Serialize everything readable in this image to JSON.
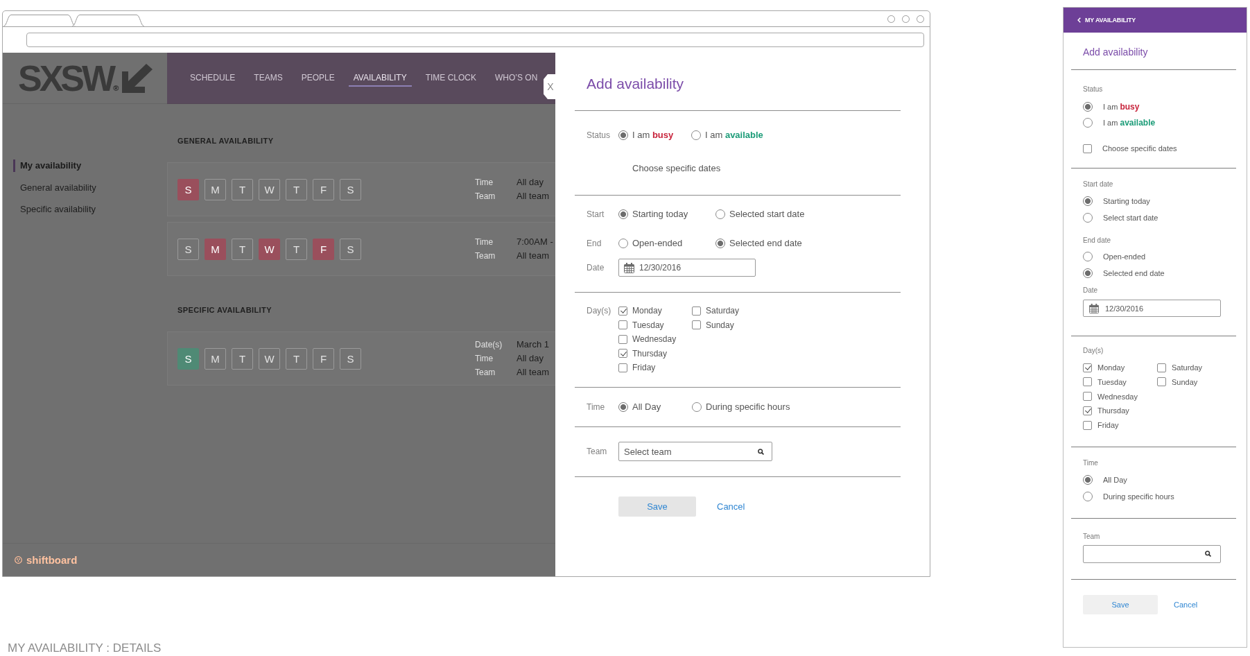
{
  "app": {
    "logo": "SXSW$_{®}$",
    "nav": [
      {
        "label": "SCHEDULE",
        "selected": false
      },
      {
        "label": "TEAMS",
        "selected": false
      },
      {
        "label": "PEOPLE",
        "selected": false
      },
      {
        "label": "AVAILABILITY",
        "selected": true
      },
      {
        "label": "TIME CLOCK",
        "selected": false
      },
      {
        "label": "WHO’S ON",
        "selected": false
      }
    ],
    "sidebar": [
      {
        "label": "My availability",
        "selected": true
      },
      {
        "label": "General availability",
        "selected": false
      },
      {
        "label": "Specific availability",
        "selected": false
      }
    ],
    "sections": [
      {
        "heading": "GENERAL AVAILABILITY",
        "cards": [
          {
            "color": "#9a4f5c",
            "days": [
              {
                "letter": "S",
                "selected": true
              },
              {
                "letter": "M",
                "selected": false
              },
              {
                "letter": "T",
                "selected": false
              },
              {
                "letter": "W",
                "selected": false
              },
              {
                "letter": "T",
                "selected": false
              },
              {
                "letter": "F",
                "selected": false
              },
              {
                "letter": "S",
                "selected": false
              }
            ],
            "details": [
              {
                "label": "Time",
                "value": "All day"
              },
              {
                "label": "Team",
                "value": "All team"
              }
            ]
          },
          {
            "color": "#9a4f5c",
            "days": [
              {
                "letter": "S",
                "selected": false
              },
              {
                "letter": "M",
                "selected": true
              },
              {
                "letter": "T",
                "selected": false
              },
              {
                "letter": "W",
                "selected": true
              },
              {
                "letter": "T",
                "selected": false
              },
              {
                "letter": "F",
                "selected": true
              },
              {
                "letter": "S",
                "selected": false
              }
            ],
            "details": [
              {
                "label": "Time",
                "value": "7:00AM -"
              },
              {
                "label": "Team",
                "value": "All team"
              }
            ]
          }
        ]
      },
      {
        "heading": "SPECIFIC AVAILABILITY",
        "cards": [
          {
            "color": "#4f8a75",
            "days": [
              {
                "letter": "S",
                "selected": true
              },
              {
                "letter": "M",
                "selected": false
              },
              {
                "letter": "T",
                "selected": false
              },
              {
                "letter": "W",
                "selected": false
              },
              {
                "letter": "T",
                "selected": false
              },
              {
                "letter": "F",
                "selected": false
              },
              {
                "letter": "S",
                "selected": false
              }
            ],
            "details": [
              {
                "label": "Date(s)",
                "value": "March 1"
              },
              {
                "label": "Time",
                "value": "All day"
              },
              {
                "label": "Team",
                "value": "All team"
              }
            ]
          }
        ]
      }
    ],
    "footer_logo": "shiftboard"
  },
  "dialog": {
    "close": "X",
    "title": "Add availability",
    "status": {
      "label": "Status",
      "options": [
        {
          "text": "I am **busy**",
          "color": "#c8243c",
          "selected": true
        },
        {
          "text": "I am **available**",
          "color": "#1c9c78",
          "selected": false
        }
      ],
      "note": "Choose specific dates"
    },
    "start": {
      "label": "Start",
      "options": [
        {
          "text": "Starting today",
          "selected": true
        },
        {
          "text": "Selected start date",
          "selected": false
        }
      ]
    },
    "end": {
      "label": "End",
      "options": [
        {
          "text": "Open-ended",
          "selected": false
        },
        {
          "text": "Selected end date",
          "selected": true
        }
      ]
    },
    "date": {
      "label": "Date",
      "value": "12/30/2016"
    },
    "days": {
      "label": "Day(s)",
      "items": [
        {
          "text": "Monday",
          "checked": true
        },
        {
          "text": "Tuesday",
          "checked": false
        },
        {
          "text": "Wednesday",
          "checked": false
        },
        {
          "text": "Thursday",
          "checked": true
        },
        {
          "text": "Friday",
          "checked": false
        },
        {
          "text": "Saturday",
          "checked": false
        },
        {
          "text": "Sunday",
          "checked": false
        }
      ]
    },
    "time": {
      "label": "Time",
      "options": [
        {
          "text": "All Day",
          "selected": true
        },
        {
          "text": "During specific hours",
          "selected": false
        }
      ]
    },
    "team": {
      "label": "Team",
      "placeholder": "Select team"
    },
    "buttons": [
      {
        "label": "Save",
        "kind": "primary"
      },
      {
        "label": "Cancel",
        "kind": "link"
      }
    ]
  },
  "mobile": {
    "back": "MY AVAILABILITY",
    "title": "Add availability",
    "status": {
      "label": "Status",
      "options": [
        {
          "text": "I am **busy**",
          "color": "#c8243c",
          "selected": true
        },
        {
          "text": "I am **available**",
          "color": "#1c9c78",
          "selected": false
        }
      ],
      "specific": {
        "text": "Choose specific dates",
        "checked": false
      }
    },
    "start": {
      "label": "Start date",
      "options": [
        {
          "text": "Starting today",
          "selected": true
        },
        {
          "text": "Select start date",
          "selected": false
        }
      ]
    },
    "end": {
      "label": "End date",
      "options": [
        {
          "text": "Open-ended",
          "selected": false
        },
        {
          "text": "Selected end date",
          "selected": true
        }
      ]
    },
    "date": {
      "label": "Date",
      "value": "12/30/2016"
    },
    "days": {
      "label": "Day(s)",
      "items": [
        {
          "text": "Monday",
          "checked": true
        },
        {
          "text": "Tuesday",
          "checked": false
        },
        {
          "text": "Wednesday",
          "checked": false
        },
        {
          "text": "Thursday",
          "checked": true
        },
        {
          "text": "Friday",
          "checked": false
        },
        {
          "text": "Saturday",
          "checked": false
        },
        {
          "text": "Sunday",
          "checked": false
        }
      ]
    },
    "time": {
      "label": "Time",
      "options": [
        {
          "text": "All Day",
          "selected": true
        },
        {
          "text": "During specific hours",
          "selected": false
        }
      ]
    },
    "team": {
      "label": "Team"
    },
    "buttons": [
      {
        "label": "Save",
        "kind": "primary"
      },
      {
        "label": "Cancel",
        "kind": "link"
      }
    ]
  },
  "caption": "MY AVAILABILITY : DETAILS"
}
